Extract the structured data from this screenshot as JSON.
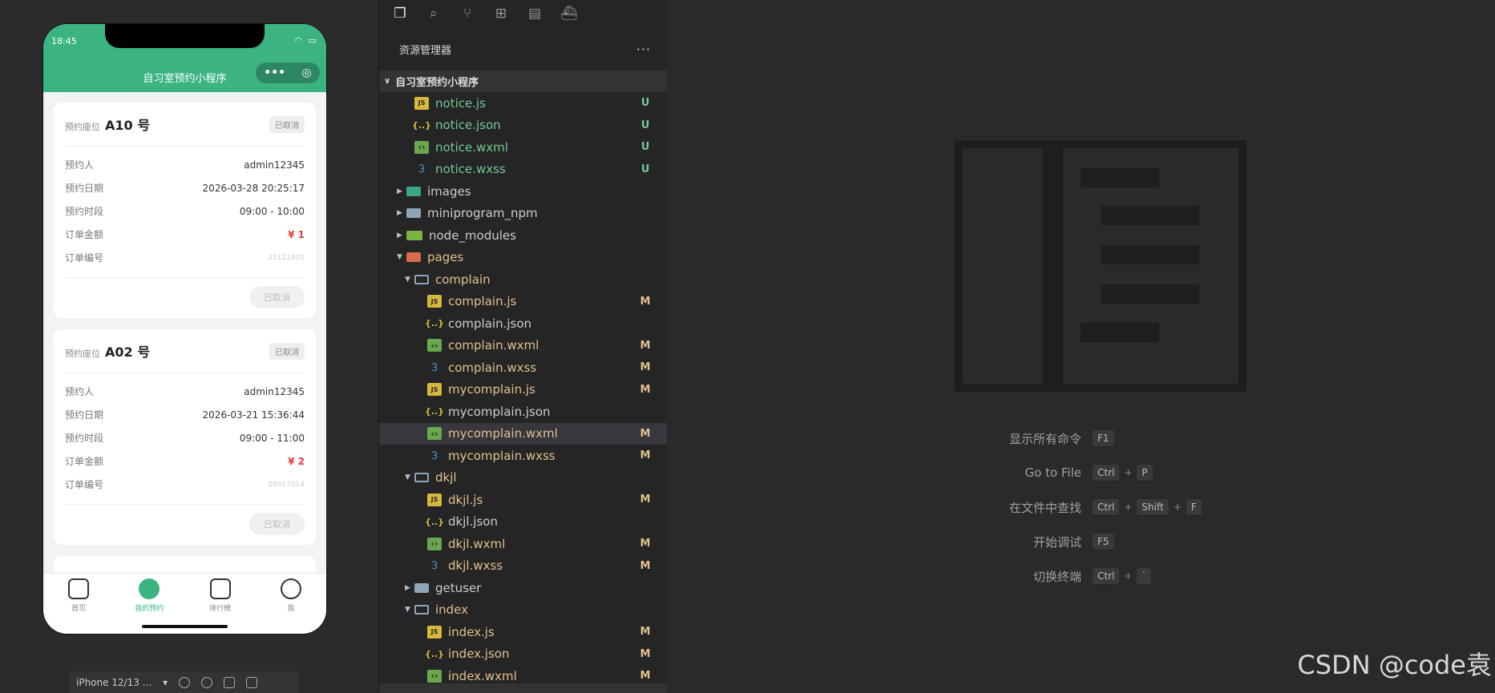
{
  "phone": {
    "time": "18:45",
    "title": "自习室预约小程序",
    "cards": [
      {
        "seat_label": "预约座位",
        "seat": "A10 号",
        "status": "已取消",
        "rows": [
          {
            "k": "预约人",
            "v": "admin12345"
          },
          {
            "k": "预约日期",
            "v": "2026-03-28 20:25:17"
          },
          {
            "k": "预约时段",
            "v": "09:00 - 10:00"
          },
          {
            "k": "订单金额",
            "v": "¥ 1"
          },
          {
            "k": "订单编号",
            "v": "25122401"
          }
        ],
        "button": "已取消"
      },
      {
        "seat_label": "预约座位",
        "seat": "A02 号",
        "status": "已取消",
        "rows": [
          {
            "k": "预约人",
            "v": "admin12345"
          },
          {
            "k": "预约日期",
            "v": "2026-03-21 15:36:44"
          },
          {
            "k": "预约时段",
            "v": "09:00 - 11:00"
          },
          {
            "k": "订单金额",
            "v": "¥ 2"
          },
          {
            "k": "订单编号",
            "v": "26017014"
          }
        ],
        "button": "已取消"
      }
    ],
    "tabs": [
      {
        "label": "首页",
        "icon": "home-icon"
      },
      {
        "label": "我的预约",
        "icon": "chat-bubble-icon"
      },
      {
        "label": "排行榜",
        "icon": "bookmark-icon"
      },
      {
        "label": "我",
        "icon": "smiley-icon"
      }
    ]
  },
  "sim_toolbar": {
    "device": "iPhone 12/13 ..."
  },
  "explorer": {
    "header": "资源管理器",
    "project": "自习室预约小程序",
    "tree": [
      {
        "name": "notice.js",
        "type": "js",
        "indent": 2,
        "status": "U"
      },
      {
        "name": "notice.json",
        "type": "json",
        "indent": 2,
        "status": "U"
      },
      {
        "name": "notice.wxml",
        "type": "wxml",
        "indent": 2,
        "status": "U"
      },
      {
        "name": "notice.wxss",
        "type": "wxss",
        "indent": 2,
        "status": "U"
      },
      {
        "name": "images",
        "type": "folder-images",
        "indent": 1,
        "arrow": "closed",
        "status": "dot-green"
      },
      {
        "name": "miniprogram_npm",
        "type": "folder",
        "indent": 1,
        "arrow": "closed",
        "status": ""
      },
      {
        "name": "node_modules",
        "type": "folder-node",
        "indent": 1,
        "arrow": "closed",
        "status": ""
      },
      {
        "name": "pages",
        "type": "folder-pages",
        "indent": 1,
        "arrow": "open",
        "status": "dot-amber"
      },
      {
        "name": "complain",
        "type": "folder-open",
        "indent": 2,
        "arrow": "open",
        "status": "dot-amber"
      },
      {
        "name": "complain.js",
        "type": "js",
        "indent": 3,
        "status": "M"
      },
      {
        "name": "complain.json",
        "type": "json",
        "indent": 3,
        "status": ""
      },
      {
        "name": "complain.wxml",
        "type": "wxml",
        "indent": 3,
        "status": "M"
      },
      {
        "name": "complain.wxss",
        "type": "wxss",
        "indent": 3,
        "status": "M"
      },
      {
        "name": "mycomplain.js",
        "type": "js",
        "indent": 3,
        "status": "M"
      },
      {
        "name": "mycomplain.json",
        "type": "json",
        "indent": 3,
        "status": ""
      },
      {
        "name": "mycomplain.wxml",
        "type": "wxml",
        "indent": 3,
        "status": "M",
        "selected": true
      },
      {
        "name": "mycomplain.wxss",
        "type": "wxss",
        "indent": 3,
        "status": "M"
      },
      {
        "name": "dkjl",
        "type": "folder-open",
        "indent": 2,
        "arrow": "open",
        "status": "dot-amber"
      },
      {
        "name": "dkjl.js",
        "type": "js",
        "indent": 3,
        "status": "M"
      },
      {
        "name": "dkjl.json",
        "type": "json",
        "indent": 3,
        "status": ""
      },
      {
        "name": "dkjl.wxml",
        "type": "wxml",
        "indent": 3,
        "status": "M"
      },
      {
        "name": "dkjl.wxss",
        "type": "wxss",
        "indent": 3,
        "status": "M"
      },
      {
        "name": "getuser",
        "type": "folder",
        "indent": 2,
        "arrow": "closed",
        "status": ""
      },
      {
        "name": "index",
        "type": "folder-open",
        "indent": 2,
        "arrow": "open",
        "status": "dot-amber"
      },
      {
        "name": "index.js",
        "type": "js",
        "indent": 3,
        "status": "M"
      },
      {
        "name": "index.json",
        "type": "json",
        "indent": 3,
        "status": "M"
      },
      {
        "name": "index.wxml",
        "type": "wxml",
        "indent": 3,
        "status": "M"
      }
    ]
  },
  "welcome": {
    "shortcuts": [
      {
        "label": "显示所有命令",
        "keys": [
          "F1"
        ]
      },
      {
        "label": "Go to File",
        "keys": [
          "Ctrl",
          "P"
        ]
      },
      {
        "label": "在文件中查找",
        "keys": [
          "Ctrl",
          "Shift",
          "F"
        ]
      },
      {
        "label": "开始调试",
        "keys": [
          "F5"
        ]
      },
      {
        "label": "切换终端",
        "keys": [
          "Ctrl",
          "`"
        ]
      }
    ]
  },
  "watermark_text": "CSDN @code袁",
  "colors": {
    "brand_green": "#3cb482",
    "untracked": "#73c991",
    "modified": "#e2c08d",
    "price_red": "#e04040"
  }
}
